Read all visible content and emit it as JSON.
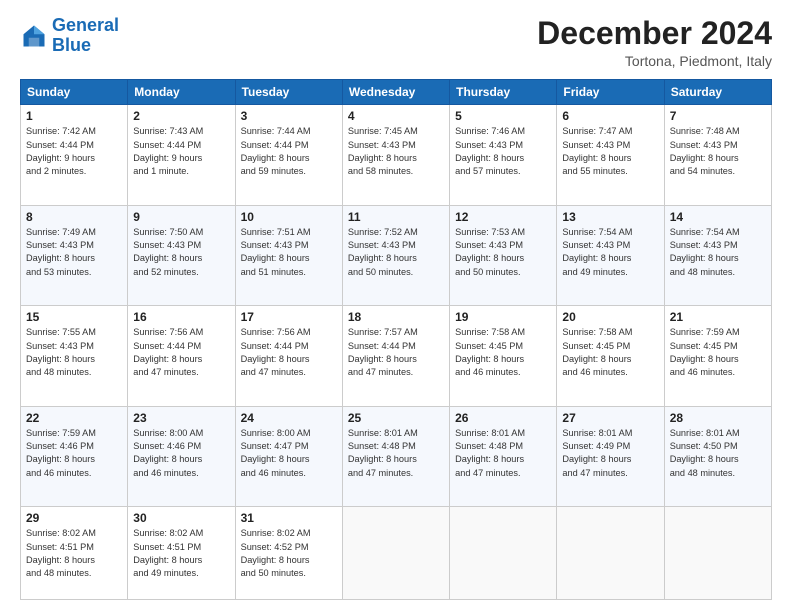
{
  "logo": {
    "line1": "General",
    "line2": "Blue"
  },
  "header": {
    "title": "December 2024",
    "subtitle": "Tortona, Piedmont, Italy"
  },
  "weekdays": [
    "Sunday",
    "Monday",
    "Tuesday",
    "Wednesday",
    "Thursday",
    "Friday",
    "Saturday"
  ],
  "weeks": [
    [
      {
        "day": "1",
        "info": "Sunrise: 7:42 AM\nSunset: 4:44 PM\nDaylight: 9 hours\nand 2 minutes."
      },
      {
        "day": "2",
        "info": "Sunrise: 7:43 AM\nSunset: 4:44 PM\nDaylight: 9 hours\nand 1 minute."
      },
      {
        "day": "3",
        "info": "Sunrise: 7:44 AM\nSunset: 4:44 PM\nDaylight: 8 hours\nand 59 minutes."
      },
      {
        "day": "4",
        "info": "Sunrise: 7:45 AM\nSunset: 4:43 PM\nDaylight: 8 hours\nand 58 minutes."
      },
      {
        "day": "5",
        "info": "Sunrise: 7:46 AM\nSunset: 4:43 PM\nDaylight: 8 hours\nand 57 minutes."
      },
      {
        "day": "6",
        "info": "Sunrise: 7:47 AM\nSunset: 4:43 PM\nDaylight: 8 hours\nand 55 minutes."
      },
      {
        "day": "7",
        "info": "Sunrise: 7:48 AM\nSunset: 4:43 PM\nDaylight: 8 hours\nand 54 minutes."
      }
    ],
    [
      {
        "day": "8",
        "info": "Sunrise: 7:49 AM\nSunset: 4:43 PM\nDaylight: 8 hours\nand 53 minutes."
      },
      {
        "day": "9",
        "info": "Sunrise: 7:50 AM\nSunset: 4:43 PM\nDaylight: 8 hours\nand 52 minutes."
      },
      {
        "day": "10",
        "info": "Sunrise: 7:51 AM\nSunset: 4:43 PM\nDaylight: 8 hours\nand 51 minutes."
      },
      {
        "day": "11",
        "info": "Sunrise: 7:52 AM\nSunset: 4:43 PM\nDaylight: 8 hours\nand 50 minutes."
      },
      {
        "day": "12",
        "info": "Sunrise: 7:53 AM\nSunset: 4:43 PM\nDaylight: 8 hours\nand 50 minutes."
      },
      {
        "day": "13",
        "info": "Sunrise: 7:54 AM\nSunset: 4:43 PM\nDaylight: 8 hours\nand 49 minutes."
      },
      {
        "day": "14",
        "info": "Sunrise: 7:54 AM\nSunset: 4:43 PM\nDaylight: 8 hours\nand 48 minutes."
      }
    ],
    [
      {
        "day": "15",
        "info": "Sunrise: 7:55 AM\nSunset: 4:43 PM\nDaylight: 8 hours\nand 48 minutes."
      },
      {
        "day": "16",
        "info": "Sunrise: 7:56 AM\nSunset: 4:44 PM\nDaylight: 8 hours\nand 47 minutes."
      },
      {
        "day": "17",
        "info": "Sunrise: 7:56 AM\nSunset: 4:44 PM\nDaylight: 8 hours\nand 47 minutes."
      },
      {
        "day": "18",
        "info": "Sunrise: 7:57 AM\nSunset: 4:44 PM\nDaylight: 8 hours\nand 47 minutes."
      },
      {
        "day": "19",
        "info": "Sunrise: 7:58 AM\nSunset: 4:45 PM\nDaylight: 8 hours\nand 46 minutes."
      },
      {
        "day": "20",
        "info": "Sunrise: 7:58 AM\nSunset: 4:45 PM\nDaylight: 8 hours\nand 46 minutes."
      },
      {
        "day": "21",
        "info": "Sunrise: 7:59 AM\nSunset: 4:45 PM\nDaylight: 8 hours\nand 46 minutes."
      }
    ],
    [
      {
        "day": "22",
        "info": "Sunrise: 7:59 AM\nSunset: 4:46 PM\nDaylight: 8 hours\nand 46 minutes."
      },
      {
        "day": "23",
        "info": "Sunrise: 8:00 AM\nSunset: 4:46 PM\nDaylight: 8 hours\nand 46 minutes."
      },
      {
        "day": "24",
        "info": "Sunrise: 8:00 AM\nSunset: 4:47 PM\nDaylight: 8 hours\nand 46 minutes."
      },
      {
        "day": "25",
        "info": "Sunrise: 8:01 AM\nSunset: 4:48 PM\nDaylight: 8 hours\nand 47 minutes."
      },
      {
        "day": "26",
        "info": "Sunrise: 8:01 AM\nSunset: 4:48 PM\nDaylight: 8 hours\nand 47 minutes."
      },
      {
        "day": "27",
        "info": "Sunrise: 8:01 AM\nSunset: 4:49 PM\nDaylight: 8 hours\nand 47 minutes."
      },
      {
        "day": "28",
        "info": "Sunrise: 8:01 AM\nSunset: 4:50 PM\nDaylight: 8 hours\nand 48 minutes."
      }
    ],
    [
      {
        "day": "29",
        "info": "Sunrise: 8:02 AM\nSunset: 4:51 PM\nDaylight: 8 hours\nand 48 minutes."
      },
      {
        "day": "30",
        "info": "Sunrise: 8:02 AM\nSunset: 4:51 PM\nDaylight: 8 hours\nand 49 minutes."
      },
      {
        "day": "31",
        "info": "Sunrise: 8:02 AM\nSunset: 4:52 PM\nDaylight: 8 hours\nand 50 minutes."
      },
      null,
      null,
      null,
      null
    ]
  ]
}
